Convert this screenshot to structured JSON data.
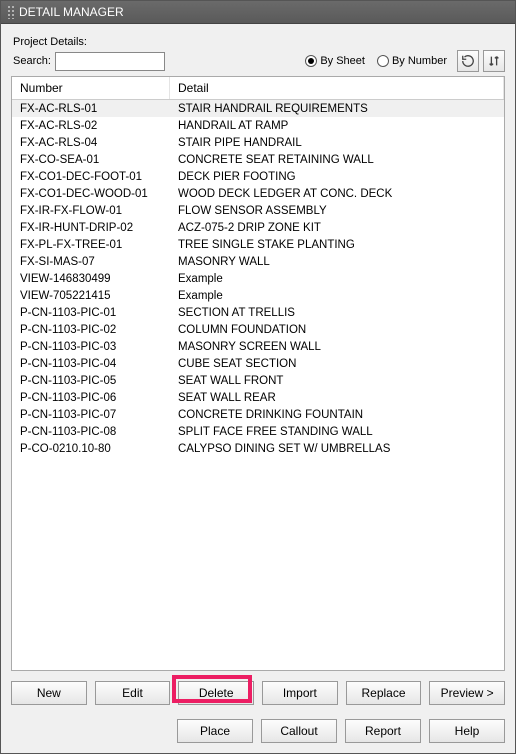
{
  "title": "DETAIL MANAGER",
  "project_label": "Project Details:",
  "search_label": "Search:",
  "search_value": "",
  "radios": {
    "by_sheet": "By Sheet",
    "by_number": "By Number",
    "selected": "by_sheet"
  },
  "columns": {
    "number": "Number",
    "detail": "Detail"
  },
  "rows": [
    {
      "number": "FX-AC-RLS-01",
      "detail": "STAIR HANDRAIL REQUIREMENTS",
      "selected": true
    },
    {
      "number": "FX-AC-RLS-02",
      "detail": "HANDRAIL AT RAMP"
    },
    {
      "number": "FX-AC-RLS-04",
      "detail": "STAIR PIPE HANDRAIL"
    },
    {
      "number": "FX-CO-SEA-01",
      "detail": "CONCRETE SEAT RETAINING WALL"
    },
    {
      "number": "FX-CO1-DEC-FOOT-01",
      "detail": "DECK PIER FOOTING"
    },
    {
      "number": "FX-CO1-DEC-WOOD-01",
      "detail": "WOOD DECK LEDGER AT CONC. DECK"
    },
    {
      "number": "FX-IR-FX-FLOW-01",
      "detail": "FLOW SENSOR ASSEMBLY"
    },
    {
      "number": "FX-IR-HUNT-DRIP-02",
      "detail": "ACZ-075-2 DRIP ZONE KIT"
    },
    {
      "number": "FX-PL-FX-TREE-01",
      "detail": "TREE SINGLE STAKE PLANTING"
    },
    {
      "number": "FX-SI-MAS-07",
      "detail": "MASONRY WALL"
    },
    {
      "number": "VIEW-146830499",
      "detail": "Example"
    },
    {
      "number": "VIEW-705221415",
      "detail": "Example"
    },
    {
      "number": "P-CN-1103-PIC-01",
      "detail": "SECTION AT TRELLIS"
    },
    {
      "number": "P-CN-1103-PIC-02",
      "detail": "COLUMN FOUNDATION"
    },
    {
      "number": "P-CN-1103-PIC-03",
      "detail": "MASONRY SCREEN WALL"
    },
    {
      "number": "P-CN-1103-PIC-04",
      "detail": "CUBE SEAT SECTION"
    },
    {
      "number": "P-CN-1103-PIC-05",
      "detail": "SEAT WALL FRONT"
    },
    {
      "number": "P-CN-1103-PIC-06",
      "detail": "SEAT WALL REAR"
    },
    {
      "number": "P-CN-1103-PIC-07",
      "detail": "CONCRETE DRINKING FOUNTAIN"
    },
    {
      "number": "P-CN-1103-PIC-08",
      "detail": "SPLIT FACE FREE STANDING WALL"
    },
    {
      "number": "P-CO-0210.10-80",
      "detail": "CALYPSO DINING SET W/ UMBRELLAS"
    }
  ],
  "buttons_top": {
    "new": "New",
    "edit": "Edit",
    "delete": "Delete",
    "import": "Import",
    "replace": "Replace",
    "preview": "Preview >"
  },
  "buttons_bottom": {
    "place": "Place",
    "callout": "Callout",
    "report": "Report",
    "help": "Help"
  },
  "highlighted_button": "delete"
}
